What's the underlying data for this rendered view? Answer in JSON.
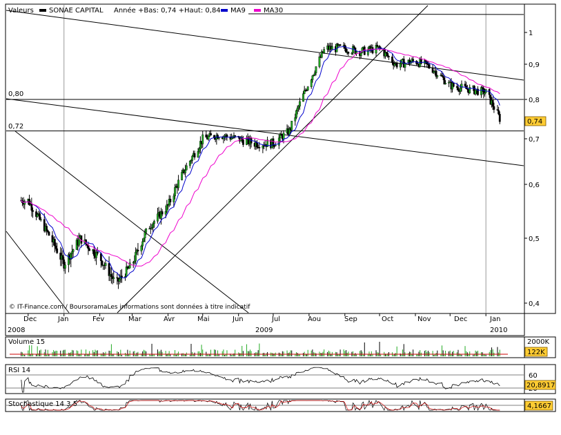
{
  "header": {
    "valeurs": "Valeurs",
    "name": "SONAE CAPITAL",
    "info": "Année +Bas: 0,74 +Haut: 0,84",
    "ma9": "MA9",
    "ma30": "MA30"
  },
  "colors": {
    "up": "#22aa22",
    "down": "#000000",
    "ma9": "#0000cc",
    "ma30": "#ee00cc",
    "badge": "#ffcc33",
    "volume_line": "#cc0000"
  },
  "credit": "© IT-Finance.com / BoursoramaLes informations sont données à titre indicatif",
  "price_badge": "0,74",
  "hline_labels": [
    "0,80",
    "0,72"
  ],
  "price_axis": [
    "1",
    "0,9",
    "0,8",
    "0,7",
    "0,6",
    "0,5",
    "0,4"
  ],
  "month_labels": [
    "Dec",
    "Jan",
    "Fev",
    "Mar",
    "Avr",
    "Mai",
    "Jun",
    "Jul",
    "Aou",
    "Sep",
    "Oct",
    "Nov",
    "Dec",
    "Jan"
  ],
  "year_labels": [
    "2008",
    "2009",
    "2010"
  ],
  "volume": {
    "title": "Volume 15",
    "axis": "2000K",
    "badge": "122K"
  },
  "rsi": {
    "title": "RSI 14",
    "axis_top": "60",
    "axis_bottom": "20",
    "badge": "20,8917"
  },
  "stoch": {
    "title": "Stochastique 14 3 5",
    "badge": "4,1667"
  },
  "chart_data": {
    "type": "candlestick",
    "title": "SONAE CAPITAL",
    "ylim": [
      0.39,
      1.05
    ],
    "y_ticks": [
      1,
      0.9,
      0.8,
      0.7,
      0.6,
      0.5,
      0.4
    ],
    "months": [
      "2008-12",
      "2009-01",
      "2009-02",
      "2009-03",
      "2009-04",
      "2009-05",
      "2009-06",
      "2009-07",
      "2009-08",
      "2009-09",
      "2009-10",
      "2009-11",
      "2009-12",
      "2010-01"
    ],
    "horizontal_levels": [
      0.8,
      0.72
    ],
    "close_series": [
      [
        "2008-12-01",
        0.57
      ],
      [
        "2008-12-15",
        0.52
      ],
      [
        "2009-01-01",
        0.46
      ],
      [
        "2009-01-15",
        0.5
      ],
      [
        "2009-02-01",
        0.47
      ],
      [
        "2009-02-15",
        0.43
      ],
      [
        "2009-03-01",
        0.46
      ],
      [
        "2009-03-15",
        0.52
      ],
      [
        "2009-04-01",
        0.56
      ],
      [
        "2009-04-15",
        0.63
      ],
      [
        "2009-05-01",
        0.7
      ],
      [
        "2009-05-15",
        0.71
      ],
      [
        "2009-06-01",
        0.7
      ],
      [
        "2009-06-15",
        0.69
      ],
      [
        "2009-07-01",
        0.69
      ],
      [
        "2009-07-15",
        0.72
      ],
      [
        "2009-08-01",
        0.85
      ],
      [
        "2009-08-15",
        0.95
      ],
      [
        "2009-09-01",
        0.95
      ],
      [
        "2009-09-15",
        0.94
      ],
      [
        "2009-10-01",
        0.95
      ],
      [
        "2009-10-15",
        0.9
      ],
      [
        "2009-11-01",
        0.91
      ],
      [
        "2009-11-15",
        0.89
      ],
      [
        "2009-12-01",
        0.84
      ],
      [
        "2009-12-15",
        0.83
      ],
      [
        "2010-01-01",
        0.82
      ],
      [
        "2010-01-15",
        0.74
      ]
    ],
    "last_close": 0.74,
    "series": [
      {
        "name": "MA9"
      },
      {
        "name": "MA30"
      }
    ]
  }
}
